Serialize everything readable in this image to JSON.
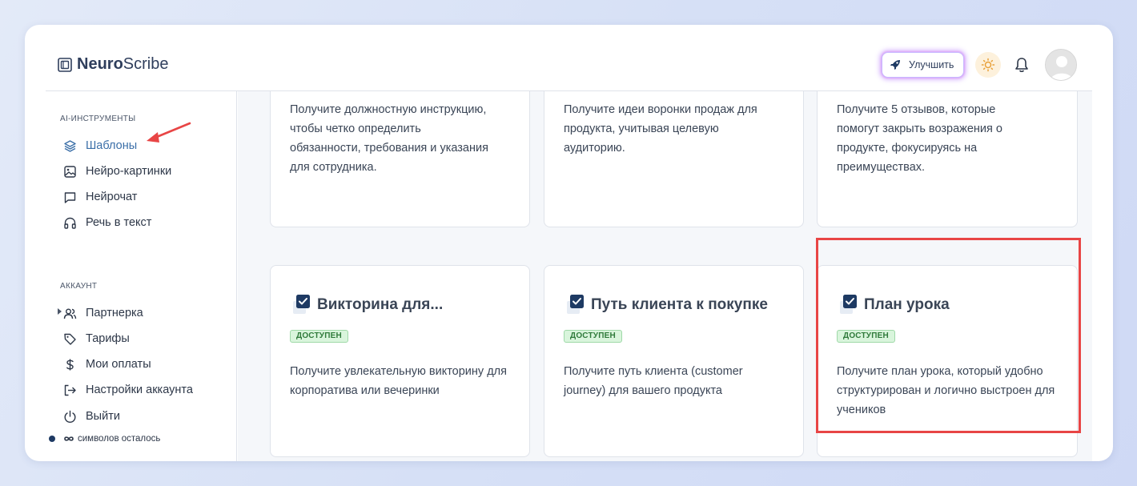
{
  "header": {
    "logo_bold": "Neuro",
    "logo_light": "Scribe",
    "upgrade_label": "Улучшить"
  },
  "sidebar": {
    "ai_section_title": "AI-ИНСТРУМЕНТЫ",
    "ai_items": [
      {
        "label": "Шаблоны",
        "icon": "layers-icon"
      },
      {
        "label": "Нейро-картинки",
        "icon": "image-icon"
      },
      {
        "label": "Нейрочат",
        "icon": "chat-icon"
      },
      {
        "label": "Речь в текст",
        "icon": "headphones-icon"
      }
    ],
    "account_section_title": "АККАУНТ",
    "account_items": [
      {
        "label": "Партнерка",
        "icon": "users-icon"
      },
      {
        "label": "Тарифы",
        "icon": "tag-icon"
      },
      {
        "label": "Мои оплаты",
        "icon": "dollar-icon"
      },
      {
        "label": "Настройки аккаунта",
        "icon": "logout-arrow-icon"
      },
      {
        "label": "Выйти",
        "icon": "power-icon"
      }
    ],
    "symbols_left": "символов осталось"
  },
  "cards_top": [
    {
      "description": "Получите должностную инструкцию, чтобы четко определить обязанности, требования и указания для сотрудника."
    },
    {
      "description": "Получите идеи воронки продаж для продукта, учитывая целевую аудиторию."
    },
    {
      "description": "Получите 5 отзывов, которые помогут закрыть возражения о продукте, фокусируясь на преимуществах."
    }
  ],
  "cards_bottom": [
    {
      "title": "Викторина для...",
      "badge": "ДОСТУПЕН",
      "description": "Получите увлекательную викторину для корпоратива или вечеринки"
    },
    {
      "title": "Путь клиента к покупке",
      "badge": "ДОСТУПЕН",
      "description": "Получите путь клиента (customer journey) для вашего продукта"
    },
    {
      "title": "План урока",
      "badge": "ДОСТУПЕН",
      "description": "Получите план урока, который удобно структурирован и логично выстроен для учеников"
    }
  ],
  "colors": {
    "accent": "#3b6fa8",
    "badge_bg": "#d9f5dc",
    "badge_text": "#2f7a3a",
    "highlight": "#e84545",
    "annotation_arrow": "#e84545"
  }
}
